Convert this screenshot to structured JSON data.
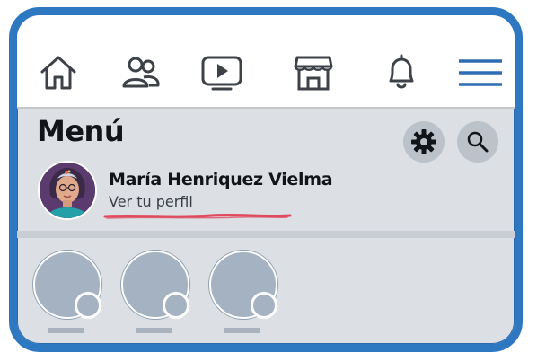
{
  "header": {
    "nav": [
      {
        "icon": "home-icon"
      },
      {
        "icon": "friends-icon"
      },
      {
        "icon": "watch-video-icon"
      },
      {
        "icon": "marketplace-icon"
      },
      {
        "icon": "notifications-bell-icon"
      },
      {
        "icon": "hamburger-menu-icon"
      }
    ]
  },
  "menu": {
    "title": "Menú",
    "settings_icon": "gear-icon",
    "search_icon": "search-icon"
  },
  "profile": {
    "name": "María Henriquez Vielma",
    "link_label": "Ver tu perfil"
  },
  "colors": {
    "frame": "#2e78c2",
    "active_tab": "#2e6db3",
    "underline_highlight": "#e04a5f",
    "background": "#dcdfe3"
  },
  "shortcuts_count": 3
}
